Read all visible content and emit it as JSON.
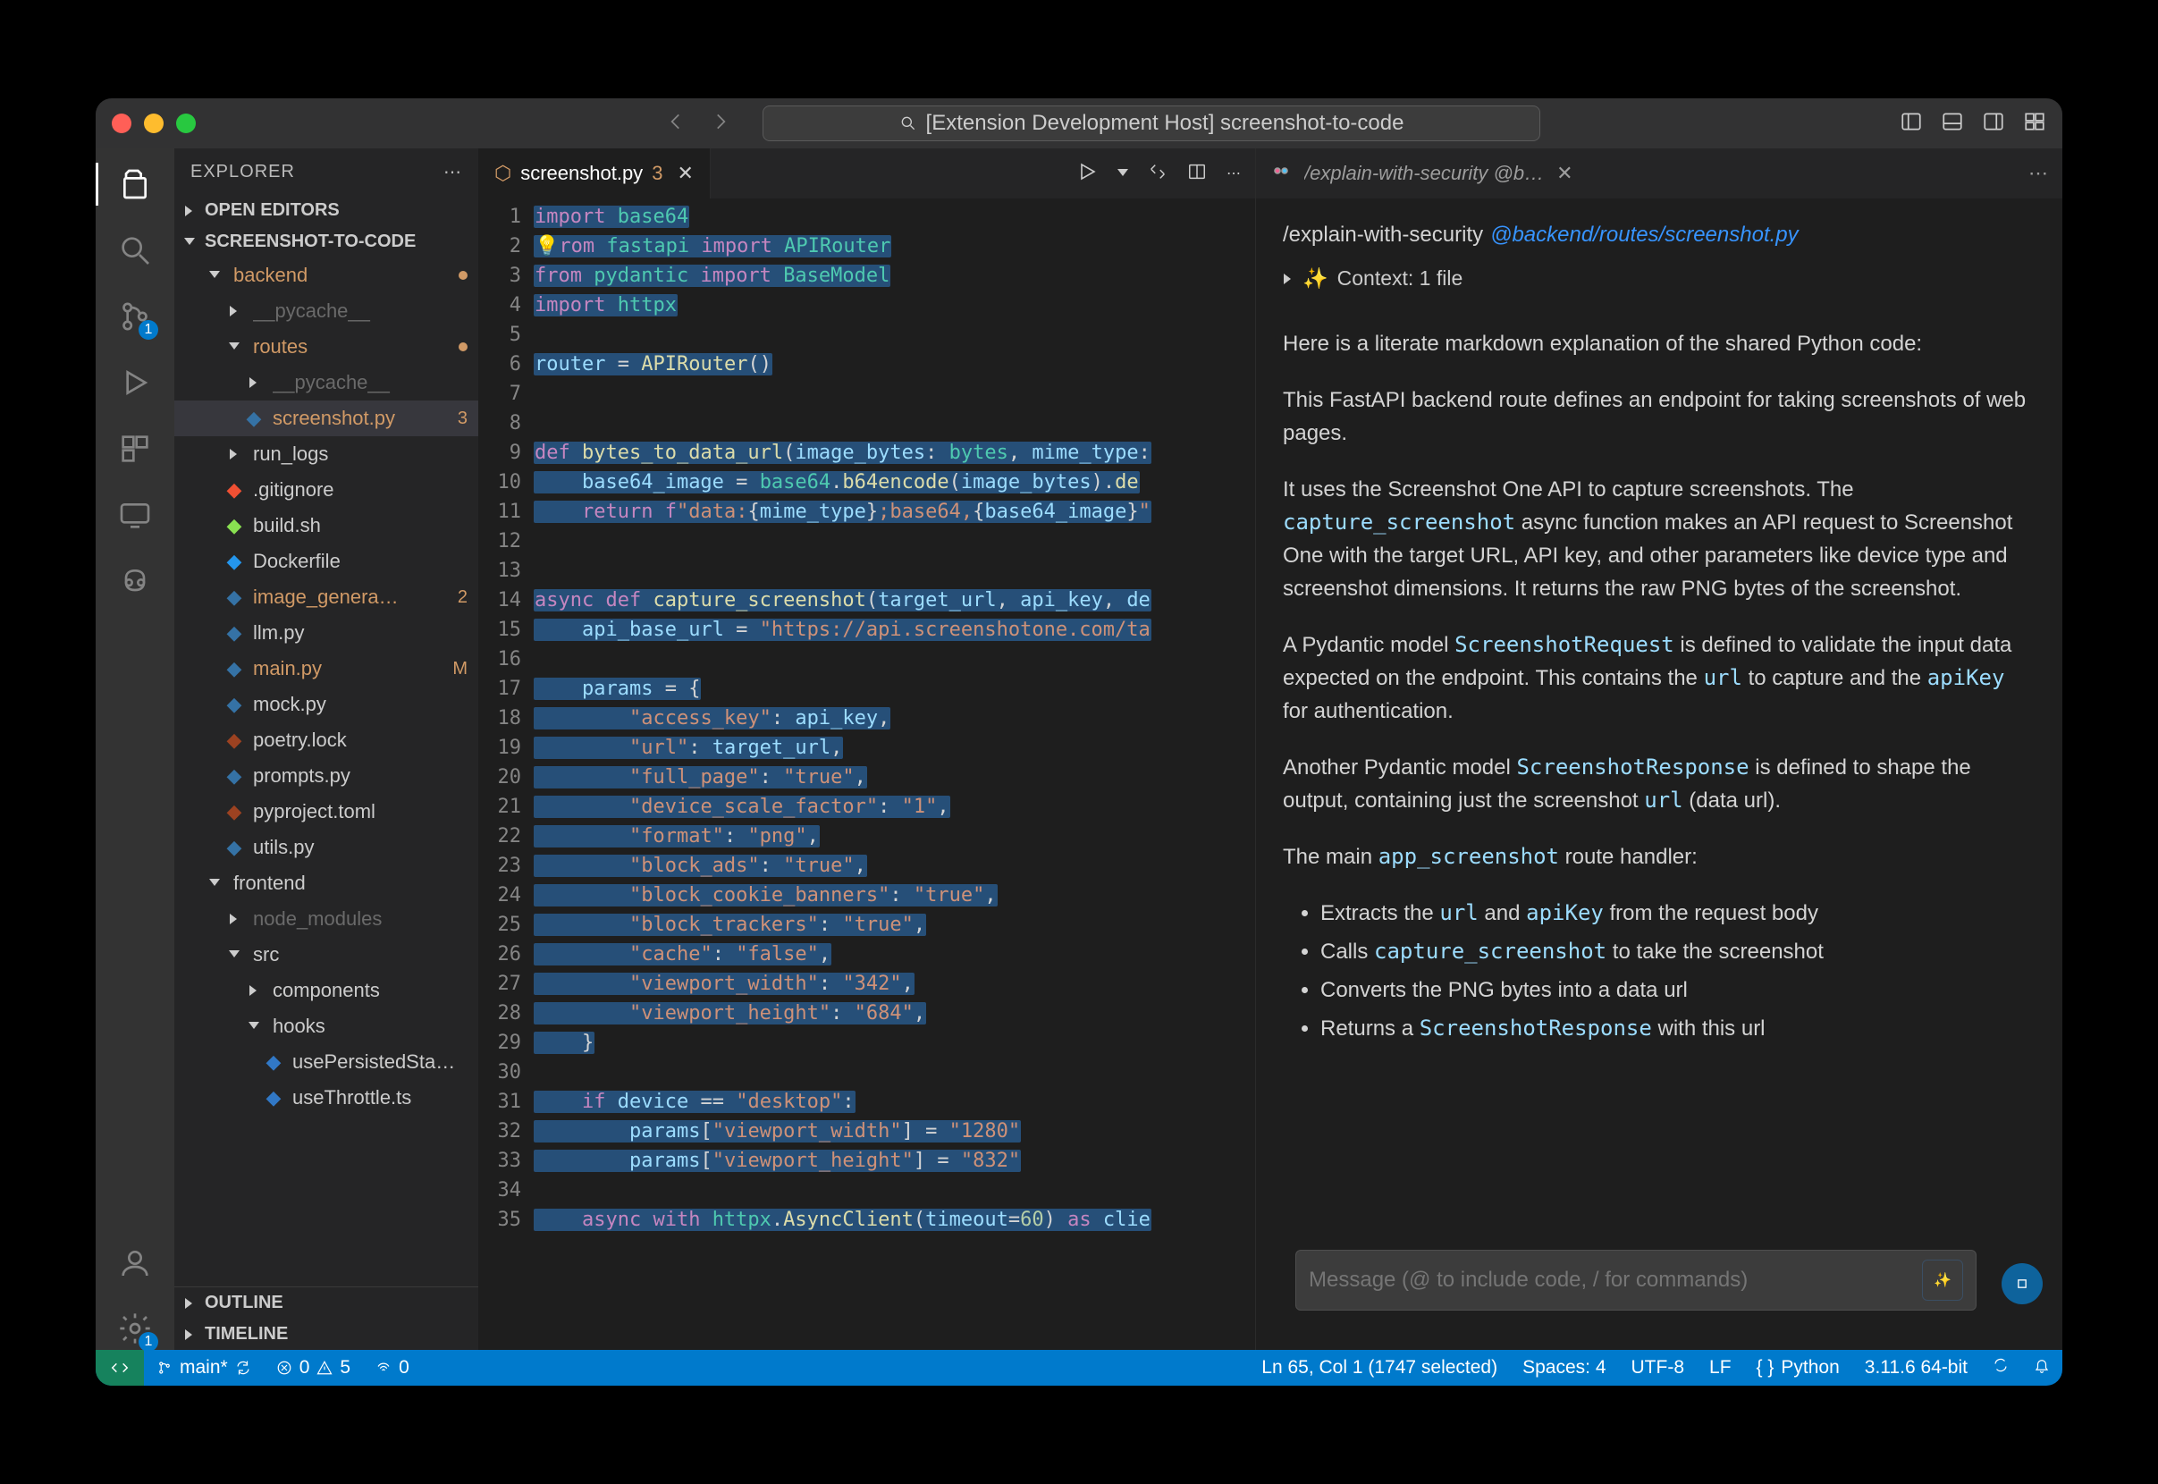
{
  "titlebar": {
    "title": "[Extension Development Host] screenshot-to-code"
  },
  "activitybar": {
    "scm_badge": "1",
    "settings_badge": "1"
  },
  "sidebar": {
    "title": "EXPLORER",
    "sections": {
      "open_editors": "OPEN EDITORS",
      "project": "SCREENSHOT-TO-CODE",
      "outline": "OUTLINE",
      "timeline": "TIMELINE"
    },
    "tree": [
      {
        "depth": 1,
        "label": "backend",
        "folder": true,
        "expanded": true,
        "mod": true,
        "dot": true
      },
      {
        "depth": 2,
        "label": "__pycache__",
        "folder": true,
        "dim": true
      },
      {
        "depth": 2,
        "label": "routes",
        "folder": true,
        "expanded": true,
        "mod": true,
        "dot": true
      },
      {
        "depth": 3,
        "label": "__pycache__",
        "folder": true,
        "dim": true
      },
      {
        "depth": 3,
        "label": "screenshot.py",
        "mod": true,
        "selected": true,
        "badge": "3",
        "icon": "py"
      },
      {
        "depth": 2,
        "label": "run_logs",
        "folder": true
      },
      {
        "depth": 2,
        "label": ".gitignore",
        "icon": "git"
      },
      {
        "depth": 2,
        "label": "build.sh",
        "icon": "sh"
      },
      {
        "depth": 2,
        "label": "Dockerfile",
        "icon": "docker"
      },
      {
        "depth": 2,
        "label": "image_genera…",
        "mod": true,
        "badge": "2",
        "icon": "py"
      },
      {
        "depth": 2,
        "label": "llm.py",
        "icon": "py"
      },
      {
        "depth": 2,
        "label": "main.py",
        "mod": true,
        "tail": "M",
        "icon": "py"
      },
      {
        "depth": 2,
        "label": "mock.py",
        "icon": "py"
      },
      {
        "depth": 2,
        "label": "poetry.lock",
        "icon": "toml"
      },
      {
        "depth": 2,
        "label": "prompts.py",
        "icon": "py"
      },
      {
        "depth": 2,
        "label": "pyproject.toml",
        "icon": "toml"
      },
      {
        "depth": 2,
        "label": "utils.py",
        "icon": "py"
      },
      {
        "depth": 1,
        "label": "frontend",
        "folder": true,
        "expanded": true
      },
      {
        "depth": 2,
        "label": "node_modules",
        "folder": true,
        "dim": true
      },
      {
        "depth": 2,
        "label": "src",
        "folder": true,
        "expanded": true
      },
      {
        "depth": 3,
        "label": "components",
        "folder": true
      },
      {
        "depth": 3,
        "label": "hooks",
        "folder": true,
        "expanded": true
      },
      {
        "depth": 4,
        "label": "usePersistedSta…",
        "icon": "ts"
      },
      {
        "depth": 4,
        "label": "useThrottle.ts",
        "icon": "ts"
      }
    ]
  },
  "editor": {
    "tab": {
      "filename": "screenshot.py",
      "count": "3"
    },
    "first_line_no": 1,
    "last_line_no": 35,
    "lines": [
      [
        [
          "kw",
          "import"
        ],
        [
          "pl",
          " "
        ],
        [
          "cl",
          "base64"
        ]
      ],
      [
        [
          "bulb",
          "💡"
        ],
        [
          "kw",
          "rom"
        ],
        [
          "pl",
          " "
        ],
        [
          "cl",
          "fastapi"
        ],
        [
          "pl",
          " "
        ],
        [
          "kw",
          "import"
        ],
        [
          "pl",
          " "
        ],
        [
          "cl",
          "APIRouter"
        ]
      ],
      [
        [
          "kw",
          "from"
        ],
        [
          "pl",
          " "
        ],
        [
          "cl",
          "pydantic"
        ],
        [
          "pl",
          " "
        ],
        [
          "kw",
          "import"
        ],
        [
          "pl",
          " "
        ],
        [
          "cl",
          "BaseModel"
        ]
      ],
      [
        [
          "kw",
          "import"
        ],
        [
          "pl",
          " "
        ],
        [
          "cl",
          "httpx"
        ]
      ],
      [],
      [
        [
          "id",
          "router"
        ],
        [
          "pl",
          " = "
        ],
        [
          "fn",
          "APIRouter"
        ],
        [
          "pl",
          "()"
        ]
      ],
      [],
      [],
      [
        [
          "kw",
          "def"
        ],
        [
          "pl",
          " "
        ],
        [
          "fn",
          "bytes_to_data_url"
        ],
        [
          "pl",
          "("
        ],
        [
          "id",
          "image_bytes"
        ],
        [
          "pl",
          ": "
        ],
        [
          "cl",
          "bytes"
        ],
        [
          "pl",
          ", "
        ],
        [
          "id",
          "mime_type"
        ],
        [
          "pl",
          ":"
        ]
      ],
      [
        [
          "pl",
          "    "
        ],
        [
          "id",
          "base64_image"
        ],
        [
          "pl",
          " = "
        ],
        [
          "cl",
          "base64"
        ],
        [
          "pl",
          "."
        ],
        [
          "fn",
          "b64encode"
        ],
        [
          "pl",
          "("
        ],
        [
          "id",
          "image_bytes"
        ],
        [
          "pl",
          ")."
        ],
        [
          "fn",
          "de"
        ]
      ],
      [
        [
          "pl",
          "    "
        ],
        [
          "kw",
          "return"
        ],
        [
          "pl",
          " "
        ],
        [
          "kw",
          "f"
        ],
        [
          "st",
          "\"data:"
        ],
        [
          "pl",
          "{"
        ],
        [
          "id",
          "mime_type"
        ],
        [
          "pl",
          "}"
        ],
        [
          "st",
          ";base64,"
        ],
        [
          "pl",
          "{"
        ],
        [
          "id",
          "base64_image"
        ],
        [
          "pl",
          "}"
        ],
        [
          "st",
          "\""
        ]
      ],
      [],
      [],
      [
        [
          "kw",
          "async def"
        ],
        [
          "pl",
          " "
        ],
        [
          "fn",
          "capture_screenshot"
        ],
        [
          "pl",
          "("
        ],
        [
          "id",
          "target_url"
        ],
        [
          "pl",
          ", "
        ],
        [
          "id",
          "api_key"
        ],
        [
          "pl",
          ", "
        ],
        [
          "id",
          "de"
        ]
      ],
      [
        [
          "pl",
          "    "
        ],
        [
          "id",
          "api_base_url"
        ],
        [
          "pl",
          " = "
        ],
        [
          "st",
          "\"https://api.screenshotone.com/ta"
        ]
      ],
      [],
      [
        [
          "pl",
          "    "
        ],
        [
          "id",
          "params"
        ],
        [
          "pl",
          " = {"
        ]
      ],
      [
        [
          "pl",
          "        "
        ],
        [
          "st",
          "\"access_key\""
        ],
        [
          "pl",
          ": "
        ],
        [
          "id",
          "api_key"
        ],
        [
          "pl",
          ","
        ]
      ],
      [
        [
          "pl",
          "        "
        ],
        [
          "st",
          "\"url\""
        ],
        [
          "pl",
          ": "
        ],
        [
          "id",
          "target_url"
        ],
        [
          "pl",
          ","
        ]
      ],
      [
        [
          "pl",
          "        "
        ],
        [
          "st",
          "\"full_page\""
        ],
        [
          "pl",
          ": "
        ],
        [
          "st",
          "\"true\""
        ],
        [
          "pl",
          ","
        ]
      ],
      [
        [
          "pl",
          "        "
        ],
        [
          "st",
          "\"device_scale_factor\""
        ],
        [
          "pl",
          ": "
        ],
        [
          "st",
          "\"1\""
        ],
        [
          "pl",
          ","
        ]
      ],
      [
        [
          "pl",
          "        "
        ],
        [
          "st",
          "\"format\""
        ],
        [
          "pl",
          ": "
        ],
        [
          "st",
          "\"png\""
        ],
        [
          "pl",
          ","
        ]
      ],
      [
        [
          "pl",
          "        "
        ],
        [
          "st",
          "\"block_ads\""
        ],
        [
          "pl",
          ": "
        ],
        [
          "st",
          "\"true\""
        ],
        [
          "pl",
          ","
        ]
      ],
      [
        [
          "pl",
          "        "
        ],
        [
          "st",
          "\"block_cookie_banners\""
        ],
        [
          "pl",
          ": "
        ],
        [
          "st",
          "\"true\""
        ],
        [
          "pl",
          ","
        ]
      ],
      [
        [
          "pl",
          "        "
        ],
        [
          "st",
          "\"block_trackers\""
        ],
        [
          "pl",
          ": "
        ],
        [
          "st",
          "\"true\""
        ],
        [
          "pl",
          ","
        ]
      ],
      [
        [
          "pl",
          "        "
        ],
        [
          "st",
          "\"cache\""
        ],
        [
          "pl",
          ": "
        ],
        [
          "st",
          "\"false\""
        ],
        [
          "pl",
          ","
        ]
      ],
      [
        [
          "pl",
          "        "
        ],
        [
          "st",
          "\"viewport_width\""
        ],
        [
          "pl",
          ": "
        ],
        [
          "st",
          "\"342\""
        ],
        [
          "pl",
          ","
        ]
      ],
      [
        [
          "pl",
          "        "
        ],
        [
          "st",
          "\"viewport_height\""
        ],
        [
          "pl",
          ": "
        ],
        [
          "st",
          "\"684\""
        ],
        [
          "pl",
          ","
        ]
      ],
      [
        [
          "pl",
          "    }"
        ]
      ],
      [],
      [
        [
          "pl",
          "    "
        ],
        [
          "kw",
          "if"
        ],
        [
          "pl",
          " "
        ],
        [
          "id",
          "device"
        ],
        [
          "pl",
          " == "
        ],
        [
          "st",
          "\"desktop\""
        ],
        [
          "pl",
          ":"
        ]
      ],
      [
        [
          "pl",
          "        "
        ],
        [
          "id",
          "params"
        ],
        [
          "pl",
          "["
        ],
        [
          "st",
          "\"viewport_width\""
        ],
        [
          "pl",
          "] = "
        ],
        [
          "st",
          "\"1280\""
        ]
      ],
      [
        [
          "pl",
          "        "
        ],
        [
          "id",
          "params"
        ],
        [
          "pl",
          "["
        ],
        [
          "st",
          "\"viewport_height\""
        ],
        [
          "pl",
          "] = "
        ],
        [
          "st",
          "\"832\""
        ]
      ],
      [],
      [
        [
          "pl",
          "    "
        ],
        [
          "kw",
          "async with"
        ],
        [
          "pl",
          " "
        ],
        [
          "cl",
          "httpx"
        ],
        [
          "pl",
          "."
        ],
        [
          "fn",
          "AsyncClient"
        ],
        [
          "pl",
          "("
        ],
        [
          "id",
          "timeout"
        ],
        [
          "pl",
          "="
        ],
        [
          "nm",
          "60"
        ],
        [
          "pl",
          ") "
        ],
        [
          "kw",
          "as"
        ],
        [
          "pl",
          " "
        ],
        [
          "id",
          "clie"
        ]
      ]
    ]
  },
  "copilot": {
    "tab_title": "/explain-with-security @b…",
    "command": "/explain-with-security",
    "path": "@backend/routes/screenshot.py",
    "context": "Context: 1 file",
    "p0": "Here is a literate markdown explanation of the shared Python code:",
    "p1": "This FastAPI backend route defines an endpoint for taking screenshots of web pages.",
    "p2a": "It uses the Screenshot One API to capture screenshots. The ",
    "p2b": "capture_screenshot",
    "p2c": " async function makes an API request to Screenshot One with the target URL, API key, and other parameters like device type and screenshot dimensions. It returns the raw PNG bytes of the screenshot.",
    "p3a": "A Pydantic model ",
    "p3b": "ScreenshotRequest",
    "p3c": " is defined to validate the input data expected on the endpoint. This contains the ",
    "p3d": "url",
    "p3e": " to capture and the ",
    "p3f": "apiKey",
    "p3g": " for authentication.",
    "p4a": "Another Pydantic model ",
    "p4b": "ScreenshotResponse",
    "p4c": " is defined to shape the output, containing just the screenshot ",
    "p4d": "url",
    "p4e": " (data url).",
    "p5a": "The main ",
    "p5b": "app_screenshot",
    "p5c": " route handler:",
    "li1a": "Extracts the ",
    "li1b": "url",
    "li1c": " and ",
    "li1d": "apiKey",
    "li1e": " from the request body",
    "li2a": "Calls ",
    "li2b": "capture_screenshot",
    "li2c": " to take the screenshot",
    "li3": "Converts the PNG bytes into a data url",
    "li4a": "Returns a ",
    "li4b": "ScreenshotResponse",
    "li4c": " with this url",
    "input_placeholder": "Message (@ to include code, / for commands)"
  },
  "status": {
    "branch": "main*",
    "errors": "0",
    "warnings": "5",
    "ports": "0",
    "cursor": "Ln 65, Col 1 (1747 selected)",
    "spaces": "Spaces: 4",
    "encoding": "UTF-8",
    "eol": "LF",
    "language": "Python",
    "runtime": "3.11.6 64-bit"
  }
}
